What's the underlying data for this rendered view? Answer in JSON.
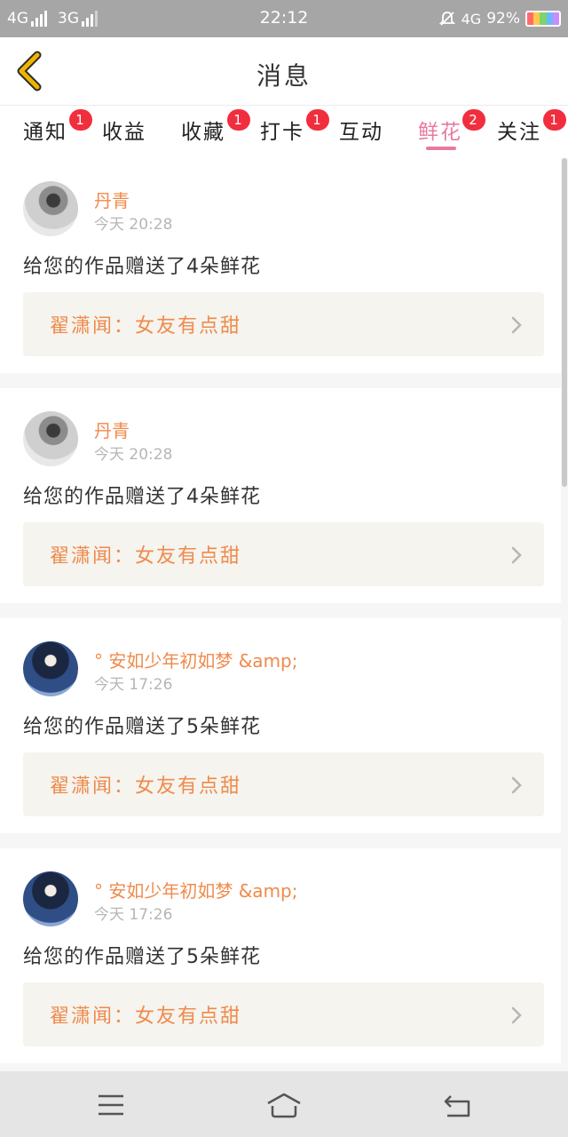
{
  "status_bar": {
    "left_network_1": "4G",
    "left_network_2": "3G",
    "time": "22:12",
    "right_network": "4G",
    "battery_percent": "92%",
    "icons": [
      "signal-icon",
      "mute-icon",
      "battery-icon"
    ]
  },
  "header": {
    "title": "消息",
    "back_icon": "chevron-left-icon",
    "accent_color": "#f0b400"
  },
  "tabs": [
    {
      "label": "通知",
      "badge": "1",
      "active": false
    },
    {
      "label": "收益",
      "badge": "",
      "active": false
    },
    {
      "label": "收藏",
      "badge": "1",
      "active": false
    },
    {
      "label": "打卡",
      "badge": "1",
      "active": false
    },
    {
      "label": "互动",
      "badge": "",
      "active": false
    },
    {
      "label": "鲜花",
      "badge": "2",
      "active": true
    },
    {
      "label": "关注",
      "badge": "1",
      "active": false
    }
  ],
  "messages": [
    {
      "user": "丹青",
      "time": "今天 20:28",
      "text": "给您的作品赠送了4朵鲜花",
      "work": "翟潇闻：女友有点甜"
    },
    {
      "user": "丹青",
      "time": "今天 20:28",
      "text": "给您的作品赠送了4朵鲜花",
      "work": "翟潇闻：女友有点甜"
    },
    {
      "user": "° 安如少年初如梦 &amp;",
      "time": "今天 17:26",
      "text": "给您的作品赠送了5朵鲜花",
      "work": "翟潇闻：女友有点甜"
    },
    {
      "user": "° 安如少年初如梦 &amp;",
      "time": "今天 17:26",
      "text": "给您的作品赠送了5朵鲜花",
      "work": "翟潇闻：女友有点甜"
    }
  ],
  "colors": {
    "active_tab": "#e879a0",
    "badge": "#f12e3e",
    "username": "#f08a4b",
    "work_text": "#f08a4b",
    "work_bg": "#f5f4ef"
  },
  "nav_bar": {
    "icons": [
      "menu-icon",
      "home-icon",
      "back-icon"
    ]
  }
}
